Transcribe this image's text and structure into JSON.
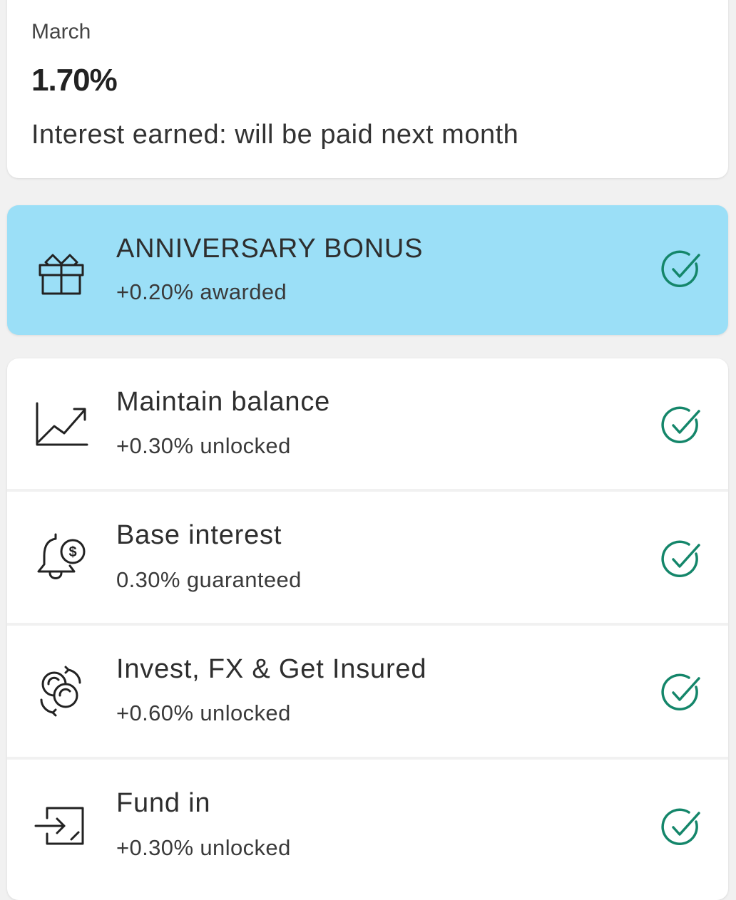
{
  "summary": {
    "month": "March",
    "rate": "1.70%",
    "note": "Interest earned: will be paid next month"
  },
  "bonus": {
    "title": "ANNIVERSARY BONUS",
    "subtitle": "+0.20% awarded",
    "icon": "gift-icon",
    "status": "check-circle-icon",
    "background": "#9bdff7"
  },
  "items": [
    {
      "title": "Maintain balance",
      "subtitle": "+0.30% unlocked",
      "icon": "trend-up-icon",
      "status": "check-circle-icon"
    },
    {
      "title": "Base interest",
      "subtitle": "0.30% guaranteed",
      "icon": "bell-dollar-icon",
      "status": "check-circle-icon"
    },
    {
      "title": "Invest, FX & Get Insured",
      "subtitle": "+0.60% unlocked",
      "icon": "coins-exchange-icon",
      "status": "check-circle-icon"
    },
    {
      "title": "Fund in",
      "subtitle": "+0.30% unlocked",
      "icon": "fund-in-icon",
      "status": "check-circle-icon"
    }
  ],
  "colors": {
    "check": "#14866a",
    "accent_blue": "#9bdff7"
  }
}
